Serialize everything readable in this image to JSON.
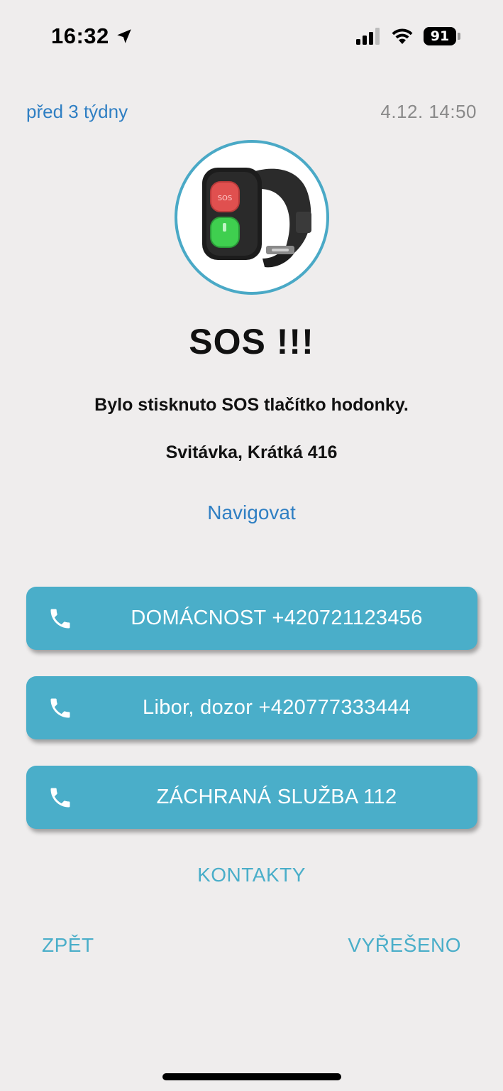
{
  "status_bar": {
    "time": "16:32",
    "battery_level": "91",
    "icons": [
      "location-arrow-icon",
      "cellular-signal-icon",
      "wifi-icon",
      "battery-icon"
    ]
  },
  "alert": {
    "relative_time": "před 3 týdny",
    "datetime": "4.12. 14:50",
    "device_image": "smartwatch-sos-bracelet",
    "title": "SOS !!!",
    "description": "Bylo stisknuto SOS tlačítko hodonky.",
    "address": "Svitávka, Krátká 416",
    "navigate_label": "Navigovat"
  },
  "contacts": [
    {
      "label": "DOMÁCNOST +420721123456",
      "icon": "phone-icon"
    },
    {
      "label": "Libor, dozor +420777333444",
      "icon": "phone-icon"
    },
    {
      "label": "ZÁCHRANÁ SLUŽBA 112",
      "icon": "phone-icon"
    }
  ],
  "actions": {
    "contacts_label": "KONTAKTY",
    "back_label": "ZPĚT",
    "resolved_label": "VYŘEŠENO"
  },
  "colors": {
    "background": "#efeded",
    "accent": "#4aaec9",
    "link_blue": "#2f7fc3"
  }
}
